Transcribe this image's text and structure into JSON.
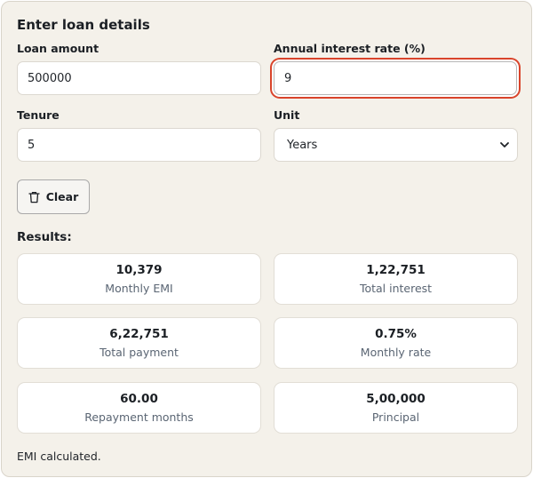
{
  "form": {
    "title": "Enter loan details",
    "loan_amount": {
      "label": "Loan amount",
      "value": "500000"
    },
    "interest_rate": {
      "label": "Annual interest rate (%)",
      "value": "9"
    },
    "tenure": {
      "label": "Tenure",
      "value": "5"
    },
    "unit": {
      "label": "Unit",
      "selected": "Years"
    },
    "clear_button": {
      "label": "Clear",
      "icon": "trash-icon"
    }
  },
  "results": {
    "label": "Results:",
    "cards": [
      {
        "value": "10,379",
        "caption": "Monthly EMI"
      },
      {
        "value": "1,22,751",
        "caption": "Total interest"
      },
      {
        "value": "6,22,751",
        "caption": "Total payment"
      },
      {
        "value": "0.75%",
        "caption": "Monthly rate"
      },
      {
        "value": "60.00",
        "caption": "Repayment months"
      },
      {
        "value": "5,00,000",
        "caption": "Principal"
      }
    ]
  },
  "status": "EMI calculated.",
  "colors": {
    "background": "#f4f1ea",
    "focus_ring": "#d9442b",
    "caption": "#5a6573"
  }
}
